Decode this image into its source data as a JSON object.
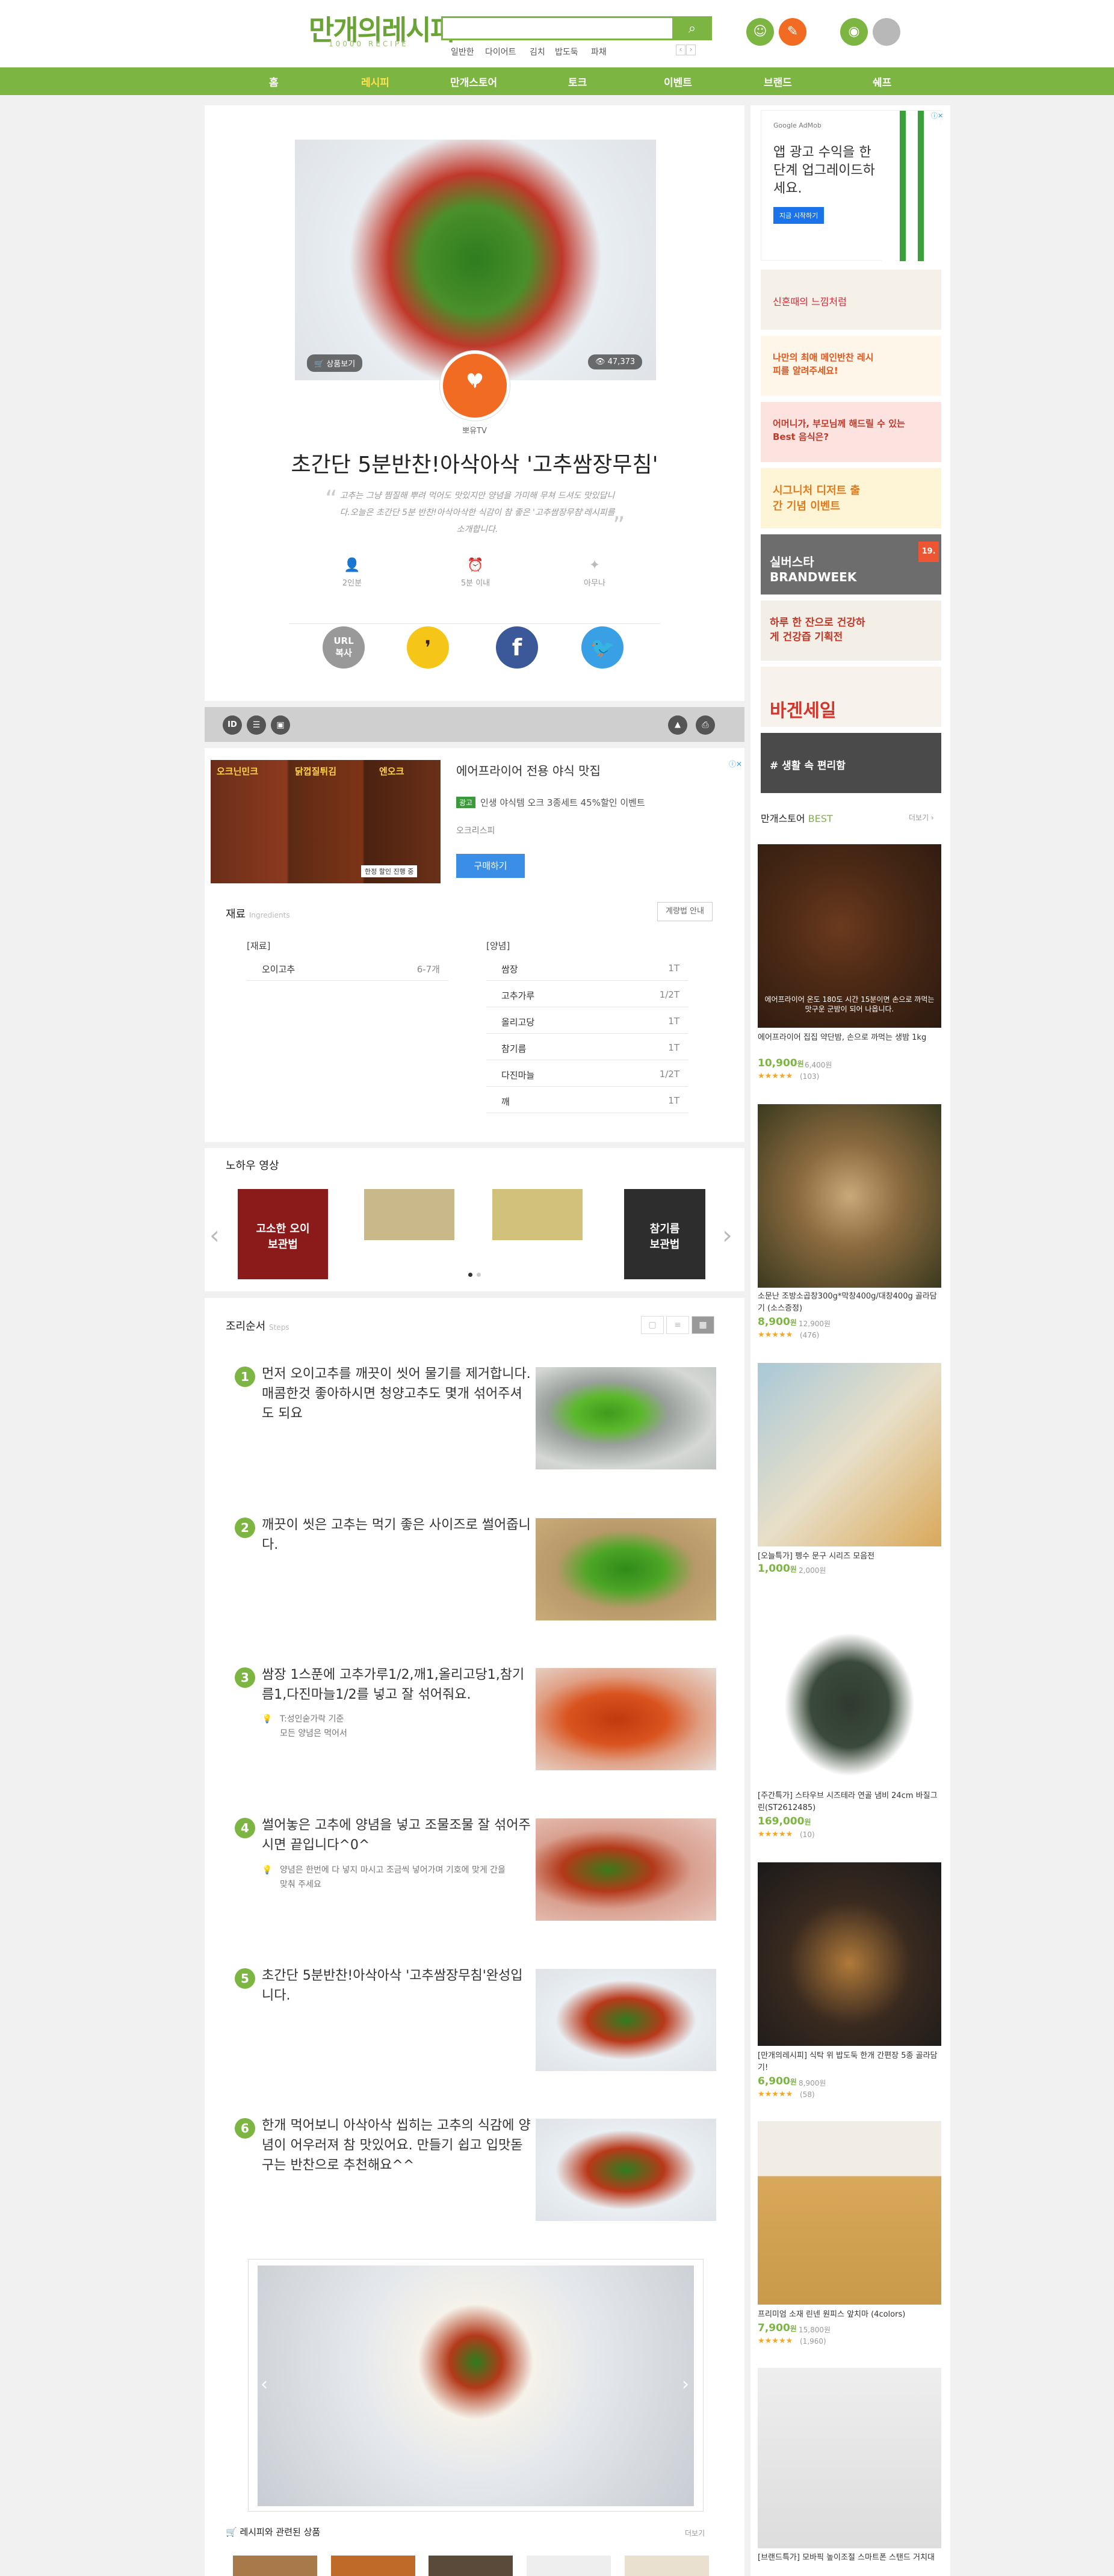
{
  "header": {
    "logo": "만개의레시피",
    "logo_sub": "10000 RECIPE",
    "search_placeholder": "",
    "search_icon": "search-icon",
    "keywords": [
      "일반한",
      "다이어트",
      "김치",
      "밥도둑",
      "파채"
    ],
    "nav_prev": "‹",
    "nav_next": "›"
  },
  "nav": [
    "홈",
    "레시피",
    "만개스토어",
    "토크",
    "이벤트",
    "브랜드",
    "쉐프"
  ],
  "recipe": {
    "badge_views_label": "상품보기",
    "view_count": "47,373",
    "author_badge": "뽀유",
    "author": "뽀유TV",
    "title": "초간단 5분반찬!아삭아삭 '고추쌈장무침'",
    "intro": "고추는 그냥 찜질해 뿌려 먹어도 맛있지만 양념을 가미해 무쳐 드셔도 맛있답니다.오늘은 초간단 5분 반찬!아삭아삭한 식감이 참 좋은 '고추쌈장무침'레시피를 소개합니다.",
    "info": [
      {
        "icon": "person-icon",
        "label": "2인분"
      },
      {
        "icon": "clock-icon",
        "label": "5분 이내"
      },
      {
        "icon": "star-icon",
        "label": "아무나"
      }
    ],
    "share": [
      {
        "label": "URL\n복사",
        "icon": "url-icon",
        "color": "#999"
      },
      {
        "label": "",
        "icon": "kakao-icon",
        "color": "#f5c518"
      },
      {
        "label": "",
        "icon": "facebook-icon",
        "color": "#3b5998"
      },
      {
        "label": "",
        "icon": "twitter-icon",
        "color": "#3aa0e6"
      }
    ]
  },
  "toolbar": [
    "ID",
    "☰",
    "▣",
    "▲",
    "⎙"
  ],
  "ad_banner": {
    "title": "에어프라이어 전용 야식 맛집",
    "badge": "광고",
    "desc": "인생 야식템 오크 3종세트 45%할인 이벤트",
    "source": "오크리스피",
    "button": "구매하기",
    "img_labels": [
      "오크닌민크",
      "닭껍질튀김",
      "엔오크"
    ],
    "img_caption": "한정 할인 진행 중"
  },
  "ingredients": {
    "title": "재료",
    "title_en": "Ingredients",
    "compare_btn": "계량법 안내",
    "group1": "[재료]",
    "items1": [
      {
        "name": "오이고추",
        "amt": "6-7개"
      }
    ],
    "group2": "[양념]",
    "items2": [
      {
        "name": "쌈장",
        "amt": "1T"
      },
      {
        "name": "고추가루",
        "amt": "1/2T"
      },
      {
        "name": "올리고당",
        "amt": "1T"
      },
      {
        "name": "참기름",
        "amt": "1T"
      },
      {
        "name": "다진마늘",
        "amt": "1/2T"
      },
      {
        "name": "깨",
        "amt": "1T"
      }
    ]
  },
  "video": {
    "title": "노하우 영상",
    "thumbs": [
      "고소한 오이\n보관법",
      "",
      "",
      "참기름\n보관법"
    ],
    "prev": "‹",
    "next": "›"
  },
  "steps": {
    "title": "조리순서",
    "title_en": "Steps",
    "items": [
      {
        "num": "1",
        "text": "먼저 오이고추를 깨끗이 씻어 물기를 제거합니다. 매콤한것 좋아하시면 청양고추도 몇개 섞어주셔도 되요",
        "tip": ""
      },
      {
        "num": "2",
        "text": "깨끗이 씻은 고추는 먹기 좋은 사이즈로 썰어줍니다.",
        "tip": ""
      },
      {
        "num": "3",
        "text": "쌈장 1스푼에 고추가루1/2,깨1,올리고당1,참기름1,다진마늘1/2를 넣고 잘 섞어줘요.",
        "tip": "T:성인숟가락 기준\n모든 양념은 먹어서"
      },
      {
        "num": "4",
        "text": "썰어놓은 고추에 양념을 넣고 조물조물 잘 섞어주시면 끝입니다^0^",
        "tip": "양념은 한번에 다 넣지 마시고 조금씩 넣어가며 기호에 맞게 간을 맞춰 주세요"
      },
      {
        "num": "5",
        "text": "초간단 5분반찬!아삭아삭 '고추쌈장무침'완성입니다.",
        "tip": ""
      },
      {
        "num": "6",
        "text": "한개 먹어보니 아삭아삭 씹히는 고추의 식감에 양념이 어우러져 참 맛있어요. 만들기 쉽고 입맛돋구는 반찬으로 추천해요^^",
        "tip": ""
      }
    ]
  },
  "related": {
    "title": "레시피와 관련된 상품",
    "more": "더보기"
  },
  "sidebar": {
    "ad1": {
      "tag": "Google AdMob",
      "text": "앱 광고 수익을 한 단계 업그레이드하세요.",
      "btn": "지금 시작하기"
    },
    "banners": [
      "신혼때의 느낌처럼",
      "나만의 최애 메인반찬 레시피를 알려주세요!",
      "어머니가, 부모님께 해드릴 수 있는 Best 음식은?",
      "시그니처 디저트 출간 기념 이벤트",
      "실버스타 BRANDWEEK",
      "하루 한 잔으로 건강하게 건강즙 기획전",
      "바겐세일",
      "# 생활 속 편리함"
    ],
    "best_title": "만개스토어",
    "best_title2": "BEST",
    "best_more": "더보기 ›",
    "products": [
      {
        "name": "에어프라이어 집집 약단밤, 손으로 까먹는 생밤 1kg",
        "price": "10,900",
        "unit": "원",
        "orig": "6,400원",
        "rev": "(103)",
        "overlay": "에어프라이어 온도 180도 시간 15분이면 손으로 까먹는 맛구운 군밤이 되어 나옵니다."
      },
      {
        "name": "소문난 조방소곱창300g*막창400g/대창400g 골라담기 (소스증정)",
        "price": "8,900",
        "unit": "원",
        "orig": "12,900원",
        "rev": "(476)",
        "overlay": ""
      },
      {
        "name": "[오늘특가] 펭수 문구 시리즈 모음전",
        "price": "1,000",
        "unit": "원",
        "orig": "2,000원",
        "rev": "",
        "overlay": ""
      },
      {
        "name": "[주간특가] 스타우브 시즈테라 연골 냄비 24cm 바질그린(ST2612485)",
        "price": "169,000",
        "unit": "원",
        "orig": "",
        "rev": "(10)",
        "overlay": ""
      },
      {
        "name": "[만개의레시피] 식탁 위 밥도둑 한개 간편장 5종 골라담기!",
        "price": "6,900",
        "unit": "원",
        "orig": "8,900원",
        "rev": "(58)",
        "overlay": ""
      },
      {
        "name": "프리미엄 소재 린넨 원피스 앞치마 (4colors)",
        "price": "7,900",
        "unit": "원",
        "orig": "15,800원",
        "rev": "(1,960)",
        "overlay": ""
      },
      {
        "name": "[브랜드특가] 모바픽 높이조절 스마트폰 스탠드 거치대",
        "price": "",
        "unit": "",
        "orig": "",
        "rev": "",
        "overlay": ""
      }
    ]
  },
  "colors": {
    "green": "#7cb542",
    "orange": "#f26b22",
    "bg": "#f1f1f2"
  }
}
